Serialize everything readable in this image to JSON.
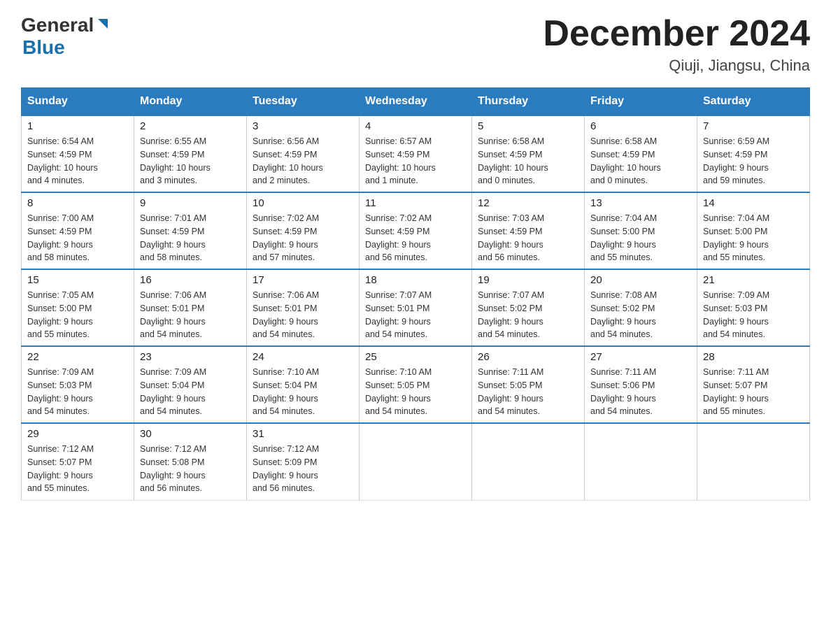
{
  "header": {
    "logo_general": "General",
    "logo_blue": "Blue",
    "month_title": "December 2024",
    "location": "Qiuji, Jiangsu, China"
  },
  "weekdays": [
    "Sunday",
    "Monday",
    "Tuesday",
    "Wednesday",
    "Thursday",
    "Friday",
    "Saturday"
  ],
  "weeks": [
    [
      {
        "day": "1",
        "sunrise": "6:54 AM",
        "sunset": "4:59 PM",
        "daylight": "10 hours and 4 minutes."
      },
      {
        "day": "2",
        "sunrise": "6:55 AM",
        "sunset": "4:59 PM",
        "daylight": "10 hours and 3 minutes."
      },
      {
        "day": "3",
        "sunrise": "6:56 AM",
        "sunset": "4:59 PM",
        "daylight": "10 hours and 2 minutes."
      },
      {
        "day": "4",
        "sunrise": "6:57 AM",
        "sunset": "4:59 PM",
        "daylight": "10 hours and 1 minute."
      },
      {
        "day": "5",
        "sunrise": "6:58 AM",
        "sunset": "4:59 PM",
        "daylight": "10 hours and 0 minutes."
      },
      {
        "day": "6",
        "sunrise": "6:58 AM",
        "sunset": "4:59 PM",
        "daylight": "10 hours and 0 minutes."
      },
      {
        "day": "7",
        "sunrise": "6:59 AM",
        "sunset": "4:59 PM",
        "daylight": "9 hours and 59 minutes."
      }
    ],
    [
      {
        "day": "8",
        "sunrise": "7:00 AM",
        "sunset": "4:59 PM",
        "daylight": "9 hours and 58 minutes."
      },
      {
        "day": "9",
        "sunrise": "7:01 AM",
        "sunset": "4:59 PM",
        "daylight": "9 hours and 58 minutes."
      },
      {
        "day": "10",
        "sunrise": "7:02 AM",
        "sunset": "4:59 PM",
        "daylight": "9 hours and 57 minutes."
      },
      {
        "day": "11",
        "sunrise": "7:02 AM",
        "sunset": "4:59 PM",
        "daylight": "9 hours and 56 minutes."
      },
      {
        "day": "12",
        "sunrise": "7:03 AM",
        "sunset": "4:59 PM",
        "daylight": "9 hours and 56 minutes."
      },
      {
        "day": "13",
        "sunrise": "7:04 AM",
        "sunset": "5:00 PM",
        "daylight": "9 hours and 55 minutes."
      },
      {
        "day": "14",
        "sunrise": "7:04 AM",
        "sunset": "5:00 PM",
        "daylight": "9 hours and 55 minutes."
      }
    ],
    [
      {
        "day": "15",
        "sunrise": "7:05 AM",
        "sunset": "5:00 PM",
        "daylight": "9 hours and 55 minutes."
      },
      {
        "day": "16",
        "sunrise": "7:06 AM",
        "sunset": "5:01 PM",
        "daylight": "9 hours and 54 minutes."
      },
      {
        "day": "17",
        "sunrise": "7:06 AM",
        "sunset": "5:01 PM",
        "daylight": "9 hours and 54 minutes."
      },
      {
        "day": "18",
        "sunrise": "7:07 AM",
        "sunset": "5:01 PM",
        "daylight": "9 hours and 54 minutes."
      },
      {
        "day": "19",
        "sunrise": "7:07 AM",
        "sunset": "5:02 PM",
        "daylight": "9 hours and 54 minutes."
      },
      {
        "day": "20",
        "sunrise": "7:08 AM",
        "sunset": "5:02 PM",
        "daylight": "9 hours and 54 minutes."
      },
      {
        "day": "21",
        "sunrise": "7:09 AM",
        "sunset": "5:03 PM",
        "daylight": "9 hours and 54 minutes."
      }
    ],
    [
      {
        "day": "22",
        "sunrise": "7:09 AM",
        "sunset": "5:03 PM",
        "daylight": "9 hours and 54 minutes."
      },
      {
        "day": "23",
        "sunrise": "7:09 AM",
        "sunset": "5:04 PM",
        "daylight": "9 hours and 54 minutes."
      },
      {
        "day": "24",
        "sunrise": "7:10 AM",
        "sunset": "5:04 PM",
        "daylight": "9 hours and 54 minutes."
      },
      {
        "day": "25",
        "sunrise": "7:10 AM",
        "sunset": "5:05 PM",
        "daylight": "9 hours and 54 minutes."
      },
      {
        "day": "26",
        "sunrise": "7:11 AM",
        "sunset": "5:05 PM",
        "daylight": "9 hours and 54 minutes."
      },
      {
        "day": "27",
        "sunrise": "7:11 AM",
        "sunset": "5:06 PM",
        "daylight": "9 hours and 54 minutes."
      },
      {
        "day": "28",
        "sunrise": "7:11 AM",
        "sunset": "5:07 PM",
        "daylight": "9 hours and 55 minutes."
      }
    ],
    [
      {
        "day": "29",
        "sunrise": "7:12 AM",
        "sunset": "5:07 PM",
        "daylight": "9 hours and 55 minutes."
      },
      {
        "day": "30",
        "sunrise": "7:12 AM",
        "sunset": "5:08 PM",
        "daylight": "9 hours and 56 minutes."
      },
      {
        "day": "31",
        "sunrise": "7:12 AM",
        "sunset": "5:09 PM",
        "daylight": "9 hours and 56 minutes."
      },
      null,
      null,
      null,
      null
    ]
  ],
  "labels": {
    "sunrise": "Sunrise:",
    "sunset": "Sunset:",
    "daylight": "Daylight:"
  }
}
